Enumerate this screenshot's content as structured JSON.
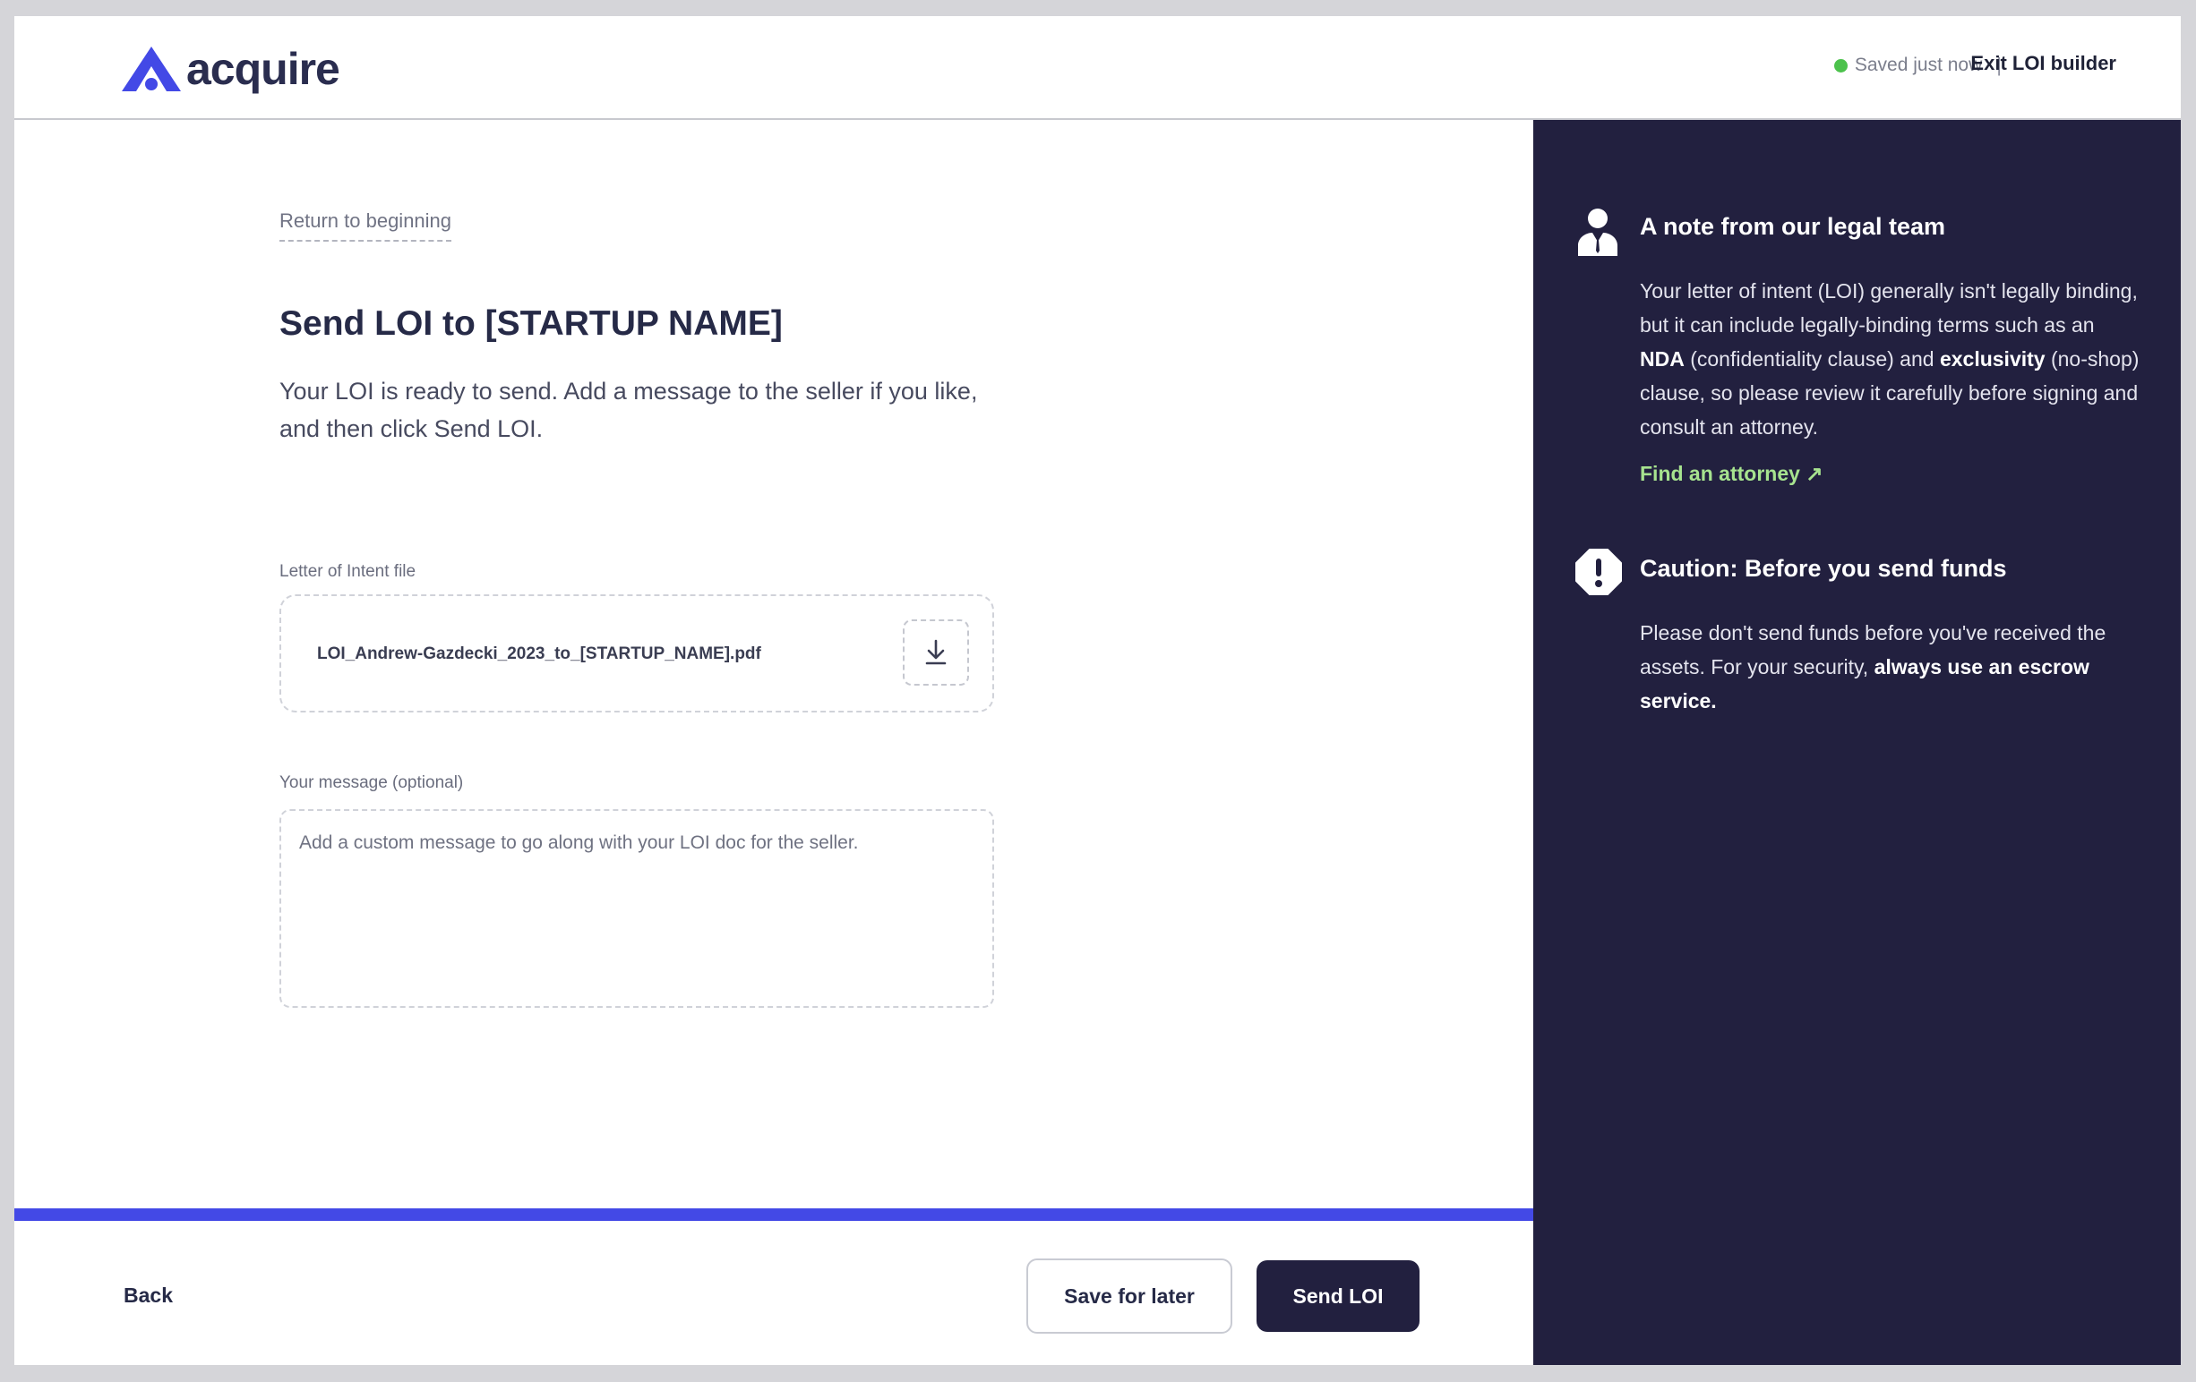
{
  "header": {
    "logo_text": "acquire",
    "save_status": "Saved just now",
    "divider": "|",
    "exit_label": "Exit LOI builder"
  },
  "main": {
    "return_link": "Return to beginning",
    "title": "Send LOI to [STARTUP NAME]",
    "description": "Your LOI is ready to send. Add a message to the seller if you like, and then click Send LOI.",
    "file_label": "Letter of Intent file",
    "file_name": "LOI_Andrew-Gazdecki_2023_to_[STARTUP_NAME].pdf",
    "message_label": "Your message (optional)",
    "message_placeholder": "Add a custom message to go along with your LOI doc for the seller.",
    "message_value": ""
  },
  "progress": {
    "fraction": 1.0,
    "color": "#4349e6"
  },
  "footer": {
    "back_label": "Back",
    "save_later_label": "Save for later",
    "send_label": "Send LOI"
  },
  "sidebar": {
    "note_title": "A note from our legal team",
    "note_body": {
      "p1": "Your letter of intent (LOI) generally isn't legally binding, but it can include legally-binding terms such as an ",
      "b1": "NDA",
      "p2": " (confidentiality clause) and ",
      "b2": "exclusivity",
      "p3": " (no-shop) clause, so please review it carefully before signing and consult an attorney."
    },
    "attorney_link": "Find an attorney ↗",
    "caution_title": "Caution: Before you send funds",
    "caution_body": {
      "p1": "Please don't send funds before you've received the assets. For your security, ",
      "b1": "always use an escrow service."
    }
  },
  "colors": {
    "brand": "#4349e6",
    "sidebar_bg": "#22203f",
    "primary_button": "#22203f",
    "status_dot": "#4cc24c",
    "link_green": "#a7e38f"
  },
  "icons": [
    "acquire-logo-icon",
    "download-icon",
    "lawyer-icon",
    "exclamation-icon"
  ]
}
